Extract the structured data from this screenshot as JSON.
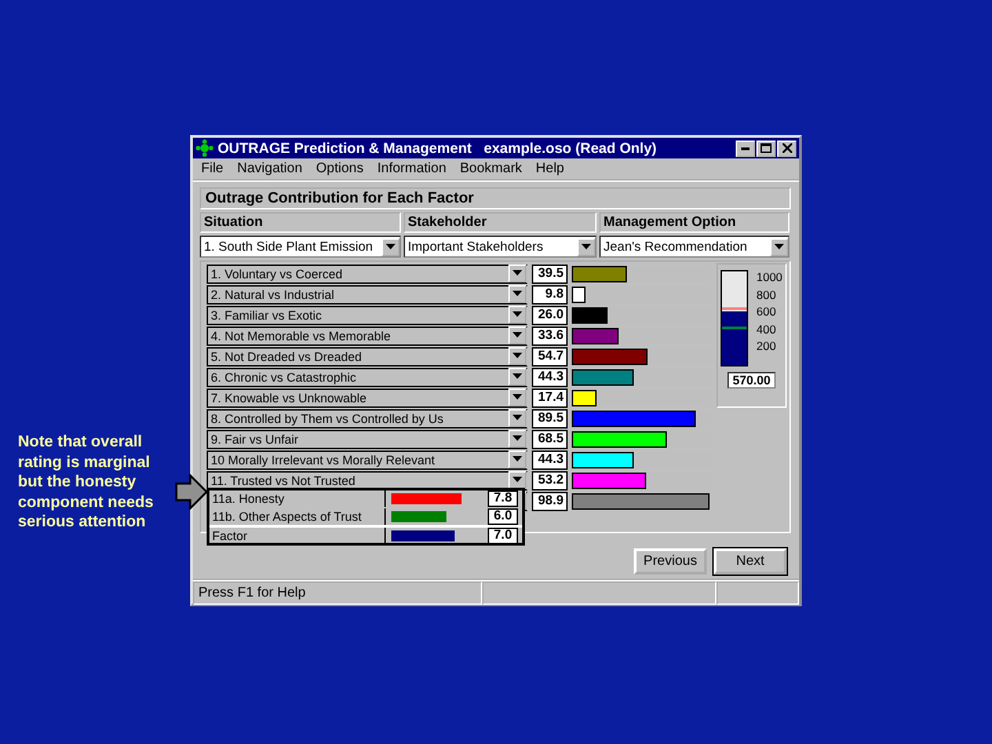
{
  "note": "Note that overall rating is marginal but the honesty component needs serious attention",
  "window": {
    "title": "OUTRAGE Prediction & Management   example.oso (Read Only)"
  },
  "menu": [
    "File",
    "Navigation",
    "Options",
    "Information",
    "Bookmark",
    "Help"
  ],
  "heading": "Outrage Contribution for Each Factor",
  "selectors": [
    {
      "label": "Situation",
      "value": "1. South Side Plant Emission"
    },
    {
      "label": "Stakeholder",
      "value": "Important Stakeholders"
    },
    {
      "label": "Management Option",
      "value": "Jean's Recommendation"
    }
  ],
  "factors": [
    {
      "label": "1.  Voluntary vs Coerced",
      "value": "39.5",
      "level": 0.395,
      "color": "#808000"
    },
    {
      "label": "2.  Natural vs Industrial",
      "value": "9.8",
      "level": 0.098,
      "color": "#ffffff"
    },
    {
      "label": "3.  Familiar vs Exotic",
      "value": "26.0",
      "level": 0.26,
      "color": "#000000"
    },
    {
      "label": "4.  Not Memorable vs Memorable",
      "value": "33.6",
      "level": 0.336,
      "color": "#800080"
    },
    {
      "label": "5.  Not Dreaded vs Dreaded",
      "value": "54.7",
      "level": 0.547,
      "color": "#800000"
    },
    {
      "label": "6.  Chronic vs Catastrophic",
      "value": "44.3",
      "level": 0.443,
      "color": "#008080"
    },
    {
      "label": "7.  Knowable vs Unknowable",
      "value": "17.4",
      "level": 0.174,
      "color": "#ffff00"
    },
    {
      "label": "8.  Controlled by Them vs Controlled by Us",
      "value": "89.5",
      "level": 0.895,
      "color": "#0000ff"
    },
    {
      "label": "9.  Fair vs Unfair",
      "value": "68.5",
      "level": 0.685,
      "color": "#00ff00"
    },
    {
      "label": "10 Morally Irrelevant vs Morally Relevant",
      "value": "44.3",
      "level": 0.443,
      "color": "#00ffff"
    },
    {
      "label": "11. Trusted vs Not Trusted",
      "value": "53.2",
      "level": 0.532,
      "color": "#ff00ff"
    },
    {
      "value": "98.9",
      "level": 0.989,
      "color": "#808080"
    }
  ],
  "breakdown": [
    {
      "label": "11a. Honesty",
      "value": "7.8",
      "level": 0.78,
      "color": "#ff0000"
    },
    {
      "label": "11b. Other Aspects of Trust",
      "value": "6.0",
      "level": 0.6,
      "color": "#008000"
    },
    {
      "label": "Factor",
      "value": "7.0",
      "level": 0.7,
      "color": "#000080"
    }
  ],
  "gauge": {
    "ticks": [
      "1000",
      "800",
      "600",
      "400",
      "200"
    ],
    "level": 0.57,
    "reading": "570.00"
  },
  "buttons": [
    "Previous",
    "Next"
  ],
  "status_bar": "Press F1 for Help"
}
